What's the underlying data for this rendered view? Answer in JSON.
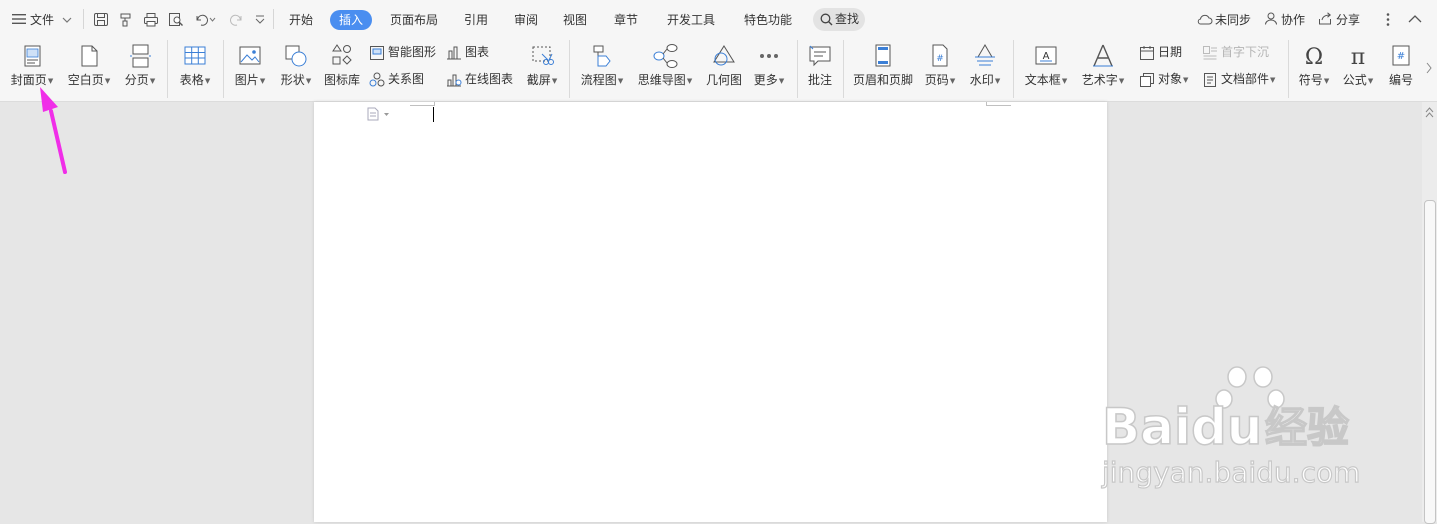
{
  "menubar": {
    "file_label": "文件",
    "tabs": [
      "开始",
      "插入",
      "页面布局",
      "引用",
      "审阅",
      "视图",
      "章节",
      "开发工具",
      "特色功能"
    ],
    "active_tab": "插入",
    "search_label": "查找",
    "right": {
      "sync": "未同步",
      "collab": "协作",
      "share": "分享"
    }
  },
  "ribbon": {
    "cover_page": "封面页",
    "blank_page": "空白页",
    "page_break": "分页",
    "table": "表格",
    "picture": "图片",
    "shape": "形状",
    "icon_library": "图标库",
    "smart_graphic": "智能图形",
    "chart": "图表",
    "relation_graph": "关系图",
    "online_chart": "在线图表",
    "screenshot": "截屏",
    "flowchart": "流程图",
    "mindmap": "思维导图",
    "geometry": "几何图",
    "more": "更多",
    "comment": "批注",
    "header_footer": "页眉和页脚",
    "page_number": "页码",
    "watermark": "水印",
    "text_box": "文本框",
    "art_text": "艺术字",
    "date": "日期",
    "drop_cap": "首字下沉",
    "object": "对象",
    "doc_parts": "文档部件",
    "symbol": "符号",
    "formula": "公式",
    "numbering": "编号"
  },
  "watermark": {
    "brand": "Baidu",
    "product": "经验",
    "url": "jingyan.baidu.com"
  },
  "colors": {
    "accent": "#4a8ef0",
    "arrow": "#f02ee8",
    "icon_blue": "#3b7fd6"
  }
}
